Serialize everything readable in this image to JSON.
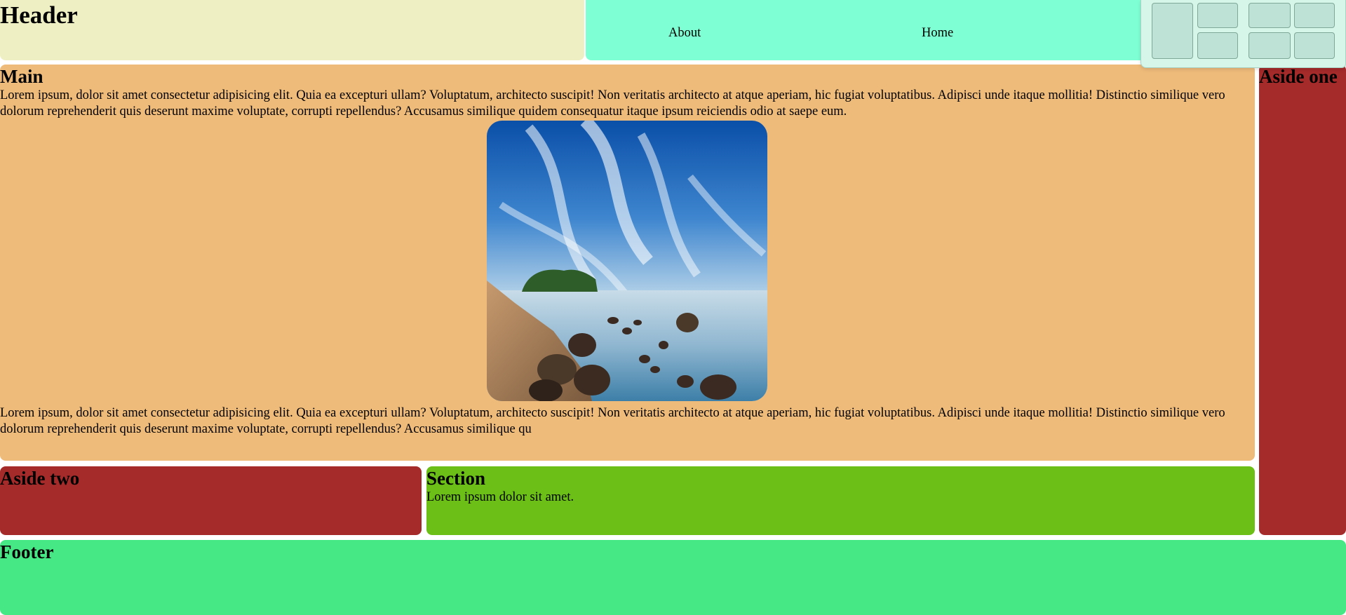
{
  "header": {
    "title": "Header"
  },
  "nav": {
    "links": [
      "About",
      "Home"
    ]
  },
  "main": {
    "title": "Main",
    "paragraph1": "Lorem ipsum, dolor sit amet consectetur adipisicing elit. Quia ea excepturi ullam? Voluptatum, architecto suscipit! Non veritatis architecto at atque aperiam, hic fugiat voluptatibus. Adipisci unde itaque mollitia! Distinctio similique vero dolorum reprehenderit quis deserunt maxime voluptate, corrupti repellendus? Accusamus similique quidem consequatur itaque ipsum reiciendis odio at saepe eum.",
    "paragraph2": "Lorem ipsum, dolor sit amet consectetur adipisicing elit. Quia ea excepturi ullam? Voluptatum, architecto suscipit! Non veritatis architecto at atque aperiam, hic fugiat voluptatibus. Adipisci unde itaque mollitia! Distinctio similique vero dolorum reprehenderit quis deserunt maxime voluptate, corrupti repellendus? Accusamus similique qu"
  },
  "aside_one": {
    "title": "Aside one"
  },
  "aside_two": {
    "title": "Aside two"
  },
  "section": {
    "title": "Section",
    "text": "Lorem ipsum dolor sit amet."
  },
  "footer": {
    "title": "Footer"
  },
  "colors": {
    "header_bg": "#efefc4",
    "nav_bg": "#7fffd4",
    "main_bg": "#efbb7a",
    "aside_bg": "#a52a2a",
    "section_bg": "#6bbf16",
    "footer_bg": "#46e886"
  },
  "icons": [
    "snap-layouts-overlay"
  ]
}
